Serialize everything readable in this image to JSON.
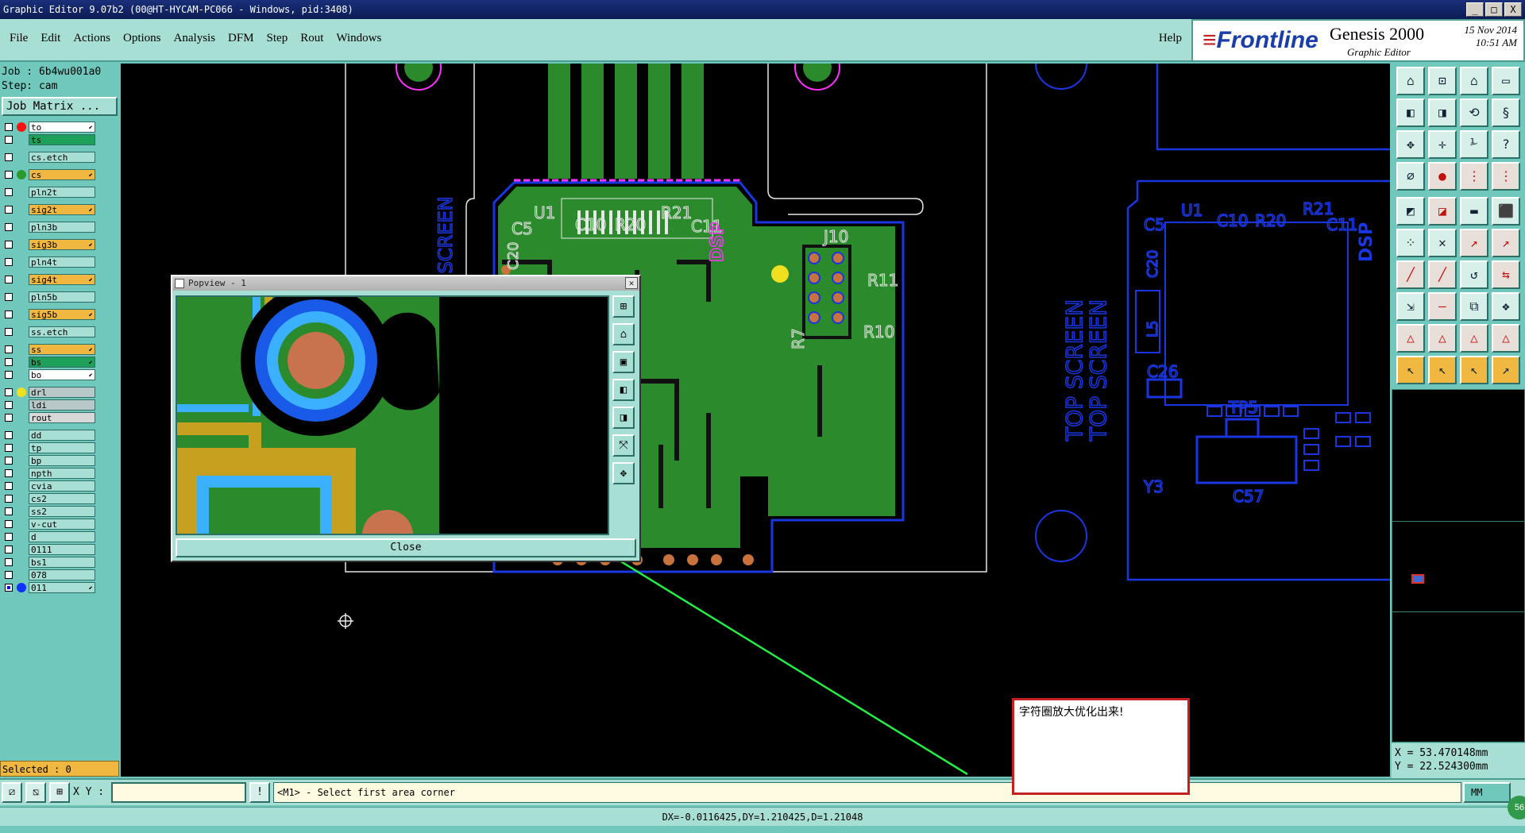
{
  "window": {
    "title": "Graphic Editor 9.07b2 (00@HT-HYCAM-PC066 - Windows, pid:3408)",
    "buttons": [
      "_",
      "□",
      "X"
    ]
  },
  "menu": {
    "items": [
      "File",
      "Edit",
      "Actions",
      "Options",
      "Analysis",
      "DFM",
      "Step",
      "Rout",
      "Windows"
    ],
    "help": "Help"
  },
  "brand": {
    "logo": "Frontline",
    "product": "Genesis 2000",
    "subtitle": "Graphic Editor",
    "date": "15 Nov 2014",
    "time": "10:51 AM"
  },
  "job": {
    "job_line": "Job : 6b4wu001a0",
    "step_line": "Step: cam",
    "matrix_label": "Job Matrix ..."
  },
  "layers": [
    {
      "name": "to",
      "dot": "#ff1010",
      "bg": "#ffffff",
      "arrow": true
    },
    {
      "name": "ts",
      "dot": "",
      "bg": "#1fa05a",
      "arrow": false
    },
    {
      "name": "sep"
    },
    {
      "name": "cs.etch",
      "dot": "",
      "bg": "#a8dfd4",
      "arrow": false
    },
    {
      "name": "sep"
    },
    {
      "name": "cs",
      "dot": "#2b9a2b",
      "bg": "#f0b840",
      "arrow": true
    },
    {
      "name": "sep"
    },
    {
      "name": "pln2t",
      "dot": "",
      "bg": "#a8dfd4",
      "arrow": false
    },
    {
      "name": "sep"
    },
    {
      "name": "sig2t",
      "dot": "",
      "bg": "#f0b840",
      "arrow": true
    },
    {
      "name": "sep"
    },
    {
      "name": "pln3b",
      "dot": "",
      "bg": "#a8dfd4",
      "arrow": false
    },
    {
      "name": "sep"
    },
    {
      "name": "sig3b",
      "dot": "",
      "bg": "#f0b840",
      "arrow": true
    },
    {
      "name": "sep"
    },
    {
      "name": "pln4t",
      "dot": "",
      "bg": "#a8dfd4",
      "arrow": false
    },
    {
      "name": "sep"
    },
    {
      "name": "sig4t",
      "dot": "",
      "bg": "#f0b840",
      "arrow": true
    },
    {
      "name": "sep"
    },
    {
      "name": "pln5b",
      "dot": "",
      "bg": "#a8dfd4",
      "arrow": false
    },
    {
      "name": "sep"
    },
    {
      "name": "sig5b",
      "dot": "",
      "bg": "#f0b840",
      "arrow": true
    },
    {
      "name": "sep"
    },
    {
      "name": "ss.etch",
      "dot": "",
      "bg": "#a8dfd4",
      "arrow": false
    },
    {
      "name": "sep"
    },
    {
      "name": "ss",
      "dot": "",
      "bg": "#f0b840",
      "arrow": true
    },
    {
      "name": "bs",
      "dot": "",
      "bg": "#1fa05a",
      "arrow": true
    },
    {
      "name": "bo",
      "dot": "",
      "bg": "#ffffff",
      "arrow": true
    },
    {
      "name": "sep"
    },
    {
      "name": "drl",
      "dot": "#f0e020",
      "bg": "#b8c8c8",
      "arrow": false
    },
    {
      "name": "ldi",
      "dot": "",
      "bg": "#b8c8c8",
      "arrow": false
    },
    {
      "name": "rout",
      "dot": "",
      "bg": "#d8d8d8",
      "arrow": false
    },
    {
      "name": "sep"
    },
    {
      "name": "dd",
      "dot": "",
      "bg": "#a8dfd4",
      "arrow": false
    },
    {
      "name": "tp",
      "dot": "",
      "bg": "#a8dfd4",
      "arrow": false
    },
    {
      "name": "bp",
      "dot": "",
      "bg": "#a8dfd4",
      "arrow": false
    },
    {
      "name": "npth",
      "dot": "",
      "bg": "#a8dfd4",
      "arrow": false
    },
    {
      "name": "cvia",
      "dot": "",
      "bg": "#a8dfd4",
      "arrow": false
    },
    {
      "name": "cs2",
      "dot": "",
      "bg": "#a8dfd4",
      "arrow": false
    },
    {
      "name": "ss2",
      "dot": "",
      "bg": "#a8dfd4",
      "arrow": false
    },
    {
      "name": "v-cut",
      "dot": "",
      "bg": "#a8dfd4",
      "arrow": false
    },
    {
      "name": "d",
      "dot": "",
      "bg": "#a8dfd4",
      "arrow": false
    },
    {
      "name": "0111",
      "dot": "",
      "bg": "#a8dfd4",
      "arrow": false
    },
    {
      "name": "bs1",
      "dot": "",
      "bg": "#a8dfd4",
      "arrow": false
    },
    {
      "name": "078",
      "dot": "",
      "bg": "#a8dfd4",
      "arrow": false
    },
    {
      "name": "011",
      "dot": "#1030ff",
      "bg": "#a8dfd4",
      "arrow": true,
      "active": true
    }
  ],
  "selected": "Selected : 0",
  "popview": {
    "title": "Popview - 1",
    "close_label": "Close"
  },
  "canvas_labels": {
    "u1": "U1",
    "c5": "C5",
    "c10": "C10",
    "r20": "R20",
    "r21": "R21",
    "c11": "C11",
    "j10": "J10",
    "r11": "R11",
    "r10": "R10",
    "r7": "R7",
    "u1b": "U1",
    "c5b": "C5",
    "c10b": "C10",
    "r20b": "R20",
    "r21b": "R21",
    "c11b": "C11",
    "c20b": "C20",
    "l5b": "L5",
    "c26b": "C26",
    "tp5b": "TP5",
    "c57b": "C57",
    "y3b": "Y3",
    "dsp": "DSP",
    "c20": "C20",
    "side_text": "TOP SCREEN"
  },
  "coords": {
    "x": "X = 53.470148mm",
    "y": "Y = 22.524300mm"
  },
  "bottom": {
    "xy_label": "X Y :",
    "xy_value": "",
    "prompt": "<M1> - Select first area corner",
    "units": "MM",
    "status": "DX=-0.0116425,DY=1.210425,D=1.21048",
    "corner_badge": "56"
  },
  "annotation": {
    "text": "字符圈放大优化出来!"
  },
  "colors": {
    "panel": "#70c8bc",
    "panel_light": "#a8dfd4",
    "copper": "#2b8a2b",
    "outline_blue": "#1a36e0",
    "silk_white": "#e8e8e8",
    "mask_magenta": "#ff30ff",
    "arrow_green": "#22ee44",
    "highlight_red": "#c42020"
  }
}
